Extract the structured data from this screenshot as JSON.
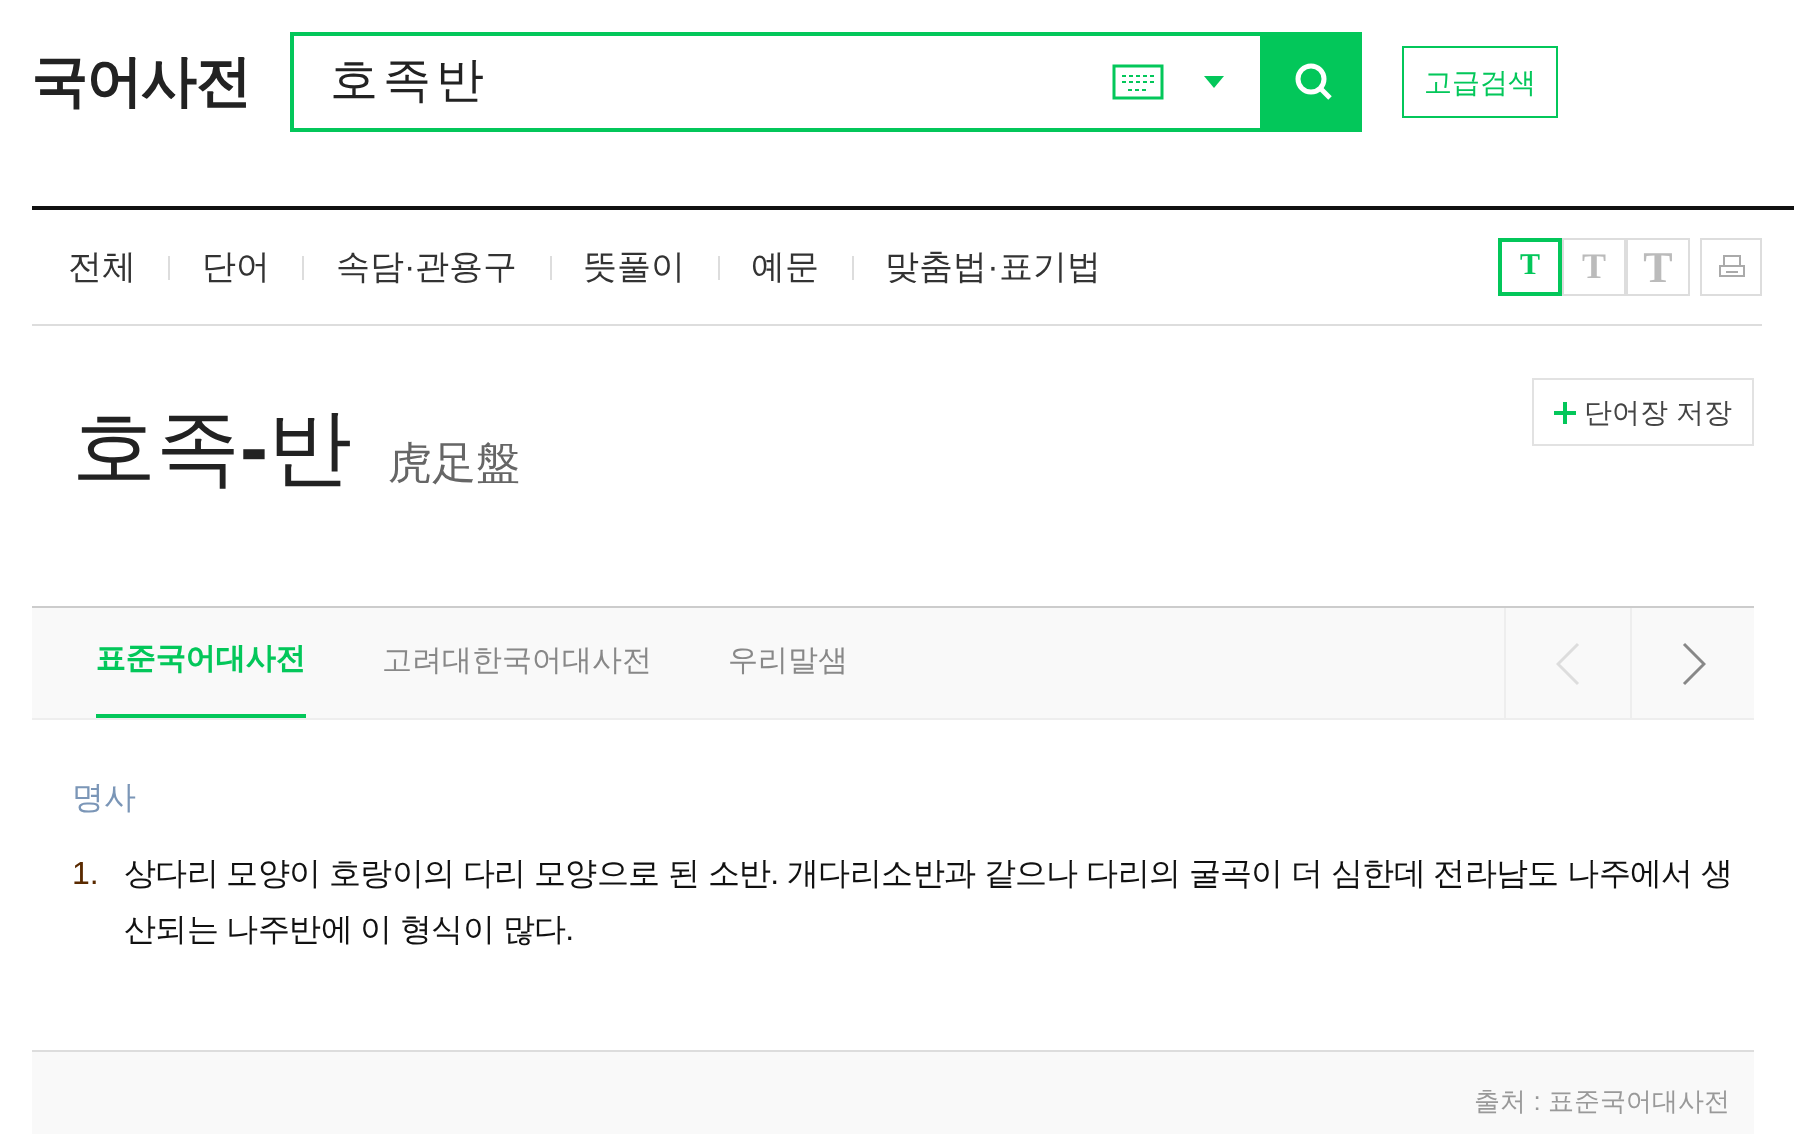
{
  "logo": "국어사전",
  "search": {
    "value": "호족반",
    "button_label": "고급검색"
  },
  "nav": [
    {
      "label": "전체",
      "selected": false
    },
    {
      "label": "단어",
      "selected": false
    },
    {
      "label": "속담·관용구",
      "selected": false
    },
    {
      "label": "뜻풀이",
      "selected": false
    },
    {
      "label": "예문",
      "selected": false
    },
    {
      "label": "맞춤법·표기법",
      "selected": false
    }
  ],
  "font_sizes": [
    {
      "label": "T",
      "selected": true
    },
    {
      "label": "T",
      "selected": false
    },
    {
      "label": "T",
      "selected": false
    }
  ],
  "entry": {
    "headword": "호족**-**반",
    "hanja": "虎足盤",
    "save_label": "단어장 저장"
  },
  "dictionary_tabs": [
    {
      "label": "표준국어대사전",
      "selected": true
    },
    {
      "label": "고려대한국어대사전",
      "selected": false
    },
    {
      "label": "우리말샘",
      "selected": false
    }
  ],
  "part_of_speech": "명사",
  "definitions": [
    {
      "number": "1.",
      "text": "상다리 모양이 호랑이의 다리 모양으로 된 소반. 개다리소반과 같으나 다리의 굴곡이 더 심한데 전라남도 나주에서 생산되는 나주반에 이 형식이 많다."
    }
  ],
  "source": "출처 : 표준국어대사전"
}
